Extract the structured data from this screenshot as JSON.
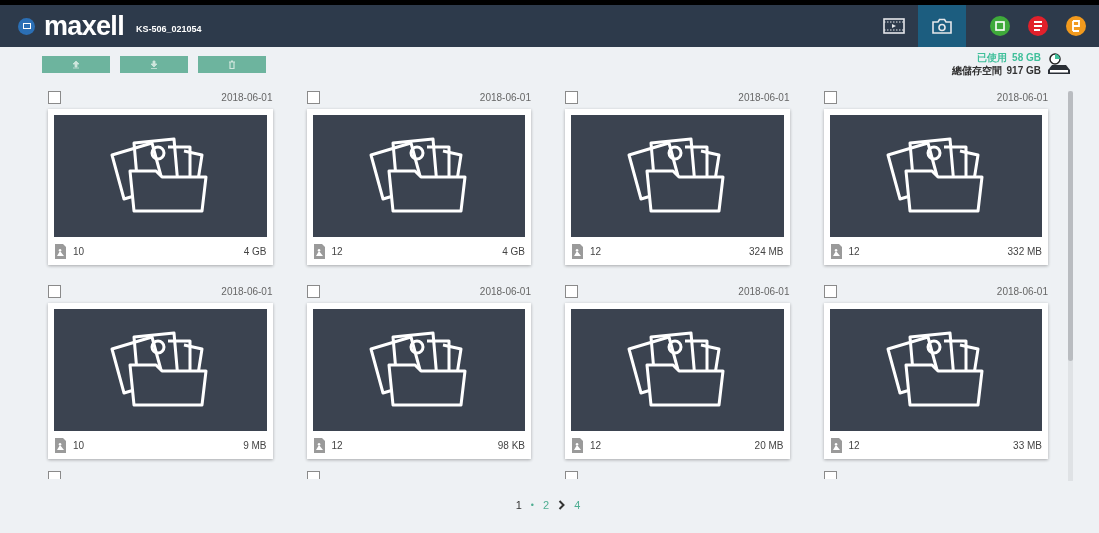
{
  "header": {
    "brand": "maxell",
    "device": "KS-506_021054",
    "tabs": [
      {
        "kind": "video",
        "selected": false
      },
      {
        "kind": "photo",
        "selected": true
      }
    ],
    "apps": [
      {
        "kind": "green",
        "color": "#3faa3a"
      },
      {
        "kind": "red",
        "color": "#e1202b"
      },
      {
        "kind": "orange",
        "color": "#f29a1d"
      }
    ]
  },
  "toolbar": {
    "buttons": [
      {
        "kind": "upload"
      },
      {
        "kind": "download"
      },
      {
        "kind": "delete"
      }
    ]
  },
  "storage": {
    "used_label": "已使用",
    "used_value": "58 GB",
    "total_label": "總儲存空間",
    "total_value": "917 GB"
  },
  "albums": [
    {
      "checked": false,
      "date": "2018-06-01",
      "count": "10",
      "size": "4 GB"
    },
    {
      "checked": false,
      "date": "2018-06-01",
      "count": "12",
      "size": "4 GB"
    },
    {
      "checked": false,
      "date": "2018-06-01",
      "count": "12",
      "size": "324 MB"
    },
    {
      "checked": false,
      "date": "2018-06-01",
      "count": "12",
      "size": "332 MB"
    },
    {
      "checked": false,
      "date": "2018-06-01",
      "count": "10",
      "size": "9 MB"
    },
    {
      "checked": false,
      "date": "2018-06-01",
      "count": "12",
      "size": "98 KB"
    },
    {
      "checked": false,
      "date": "2018-06-01",
      "count": "12",
      "size": "20 MB"
    },
    {
      "checked": false,
      "date": "2018-06-01",
      "count": "12",
      "size": "33 MB"
    }
  ],
  "partial_row": [
    {
      "checked": false
    },
    {
      "checked": false
    },
    {
      "checked": false
    },
    {
      "checked": false
    }
  ],
  "pagination": [
    {
      "kind": "page",
      "label": "1",
      "selected": true
    },
    {
      "kind": "dot",
      "label": "•"
    },
    {
      "kind": "page",
      "label": "2",
      "selected": false
    },
    {
      "kind": "next"
    },
    {
      "kind": "page",
      "label": "4",
      "selected": false
    }
  ]
}
